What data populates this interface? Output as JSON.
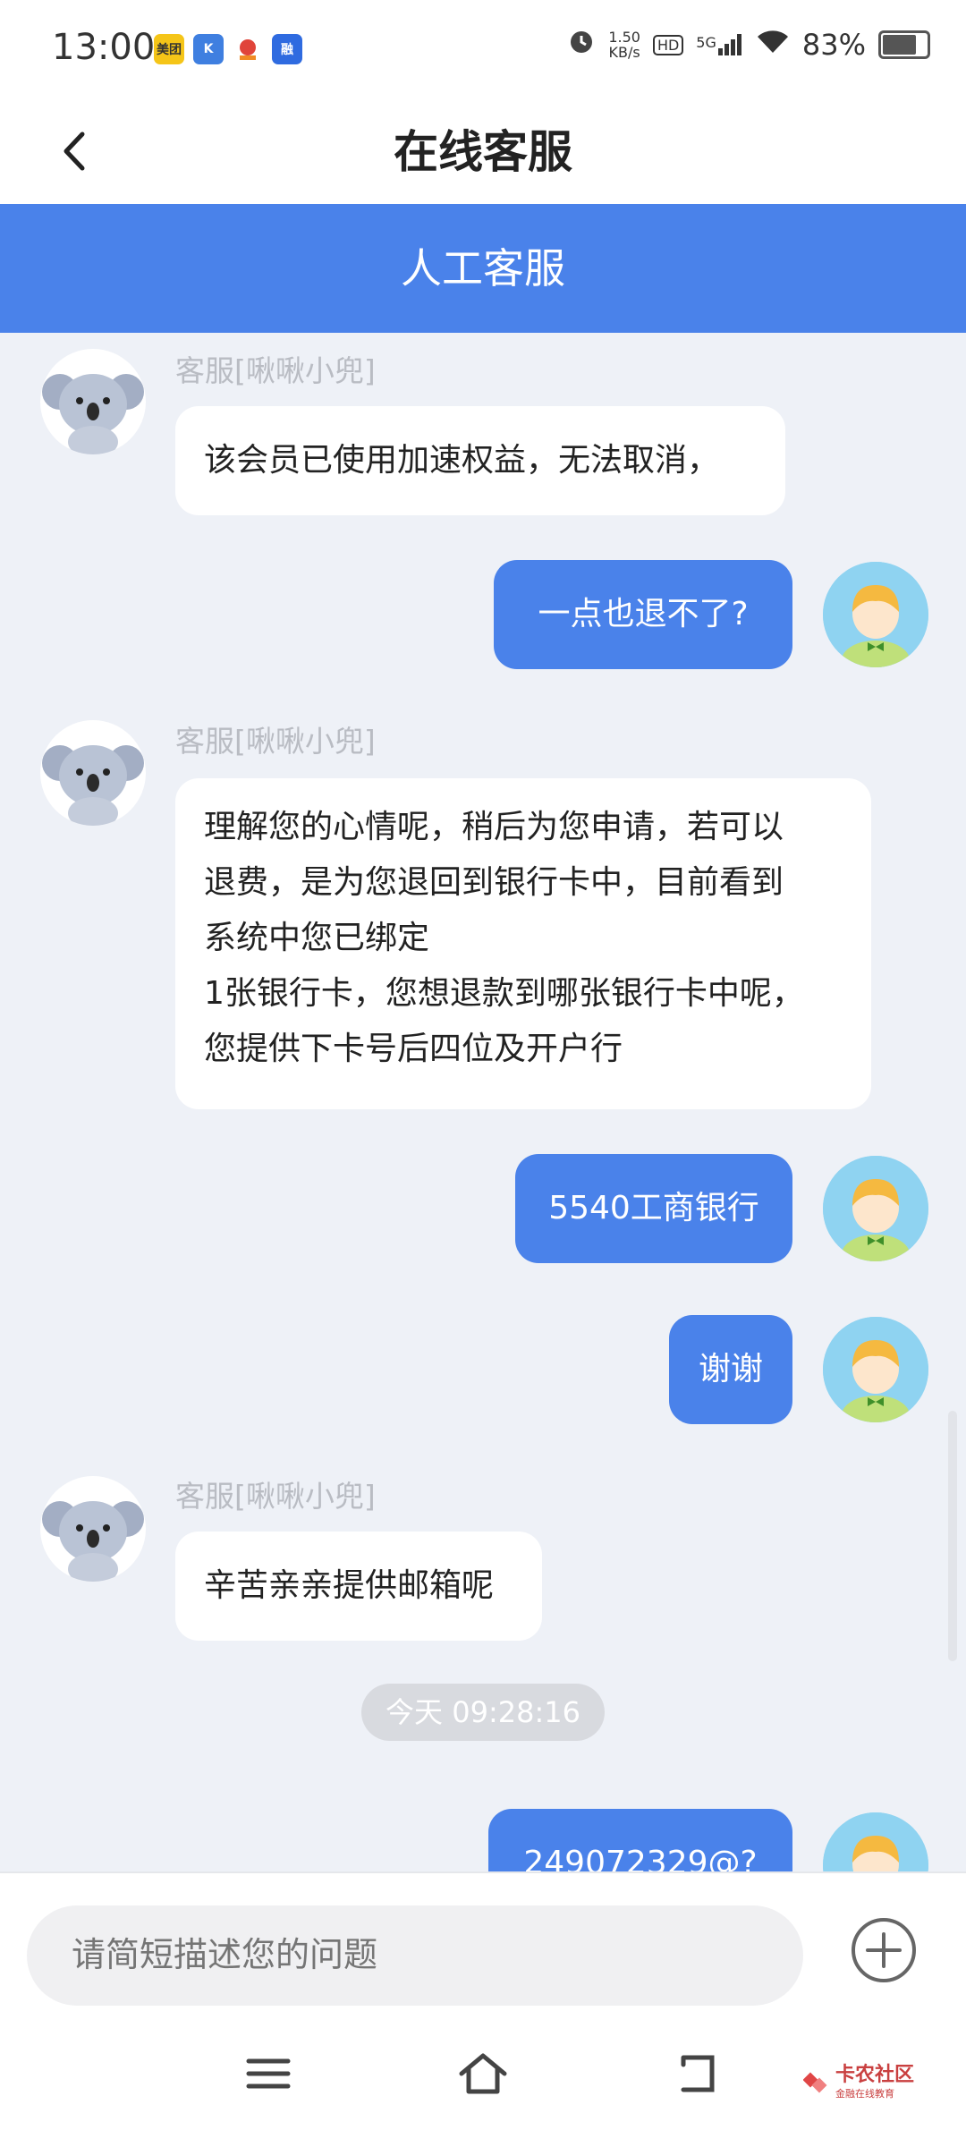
{
  "status_bar": {
    "time": "13:00",
    "apps": [
      {
        "icon": "meituan-icon",
        "text": "美团",
        "color": "#f5c518"
      },
      {
        "icon": "k-app-icon",
        "text": "K",
        "color": "#3f7fe0"
      },
      {
        "icon": "app-red-icon",
        "text": "",
        "color": "#e0443a"
      },
      {
        "icon": "rong-app-icon",
        "text": "融",
        "color": "#2f6be0"
      }
    ],
    "net_speed_value": "1.50",
    "net_speed_unit": "KB/s",
    "hd": "HD",
    "signal": "5G",
    "battery": "83%",
    "battery_level": 0.83
  },
  "nav": {
    "title": "在线客服"
  },
  "banner": {
    "title": "人工客服"
  },
  "chat": {
    "agent_name": "客服[啾啾小兜]",
    "messages": [
      {
        "from": "agent",
        "name": "客服[啾啾小兜]",
        "text": "该会员已使用加速权益，无法取消，"
      },
      {
        "from": "user",
        "text": "一点也退不了?"
      },
      {
        "from": "agent",
        "name": "客服[啾啾小兜]",
        "lines": [
          "理解您的心情呢，稍后为您申请，若可以",
          "退费，是为您退回到银行卡中，目前看到",
          "系统中您已绑定",
          "1张银行卡，您想退款到哪张银行卡中呢，",
          "您提供下卡号后四位及开户行"
        ]
      },
      {
        "from": "user",
        "text": "5540工商银行"
      },
      {
        "from": "user",
        "text": "谢谢"
      },
      {
        "from": "agent",
        "name": "客服[啾啾小兜]",
        "text": "辛苦亲亲提供邮箱呢"
      },
      {
        "from": "user",
        "text": "249072329@?"
      }
    ],
    "timestamp": "今天 09:28:16"
  },
  "input": {
    "placeholder": "请简短描述您的问题"
  },
  "watermark": {
    "title": "卡农社区",
    "subtitle": "金融在线教育"
  },
  "colors": {
    "accent": "#4a82ea",
    "background": "#eef1f7"
  }
}
